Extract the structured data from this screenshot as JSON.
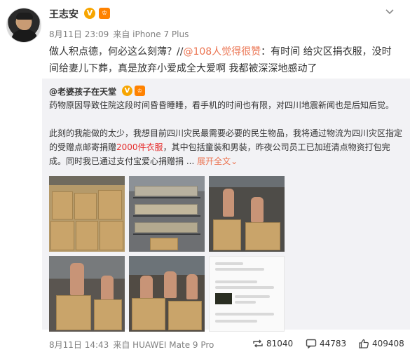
{
  "post": {
    "author": "王志安",
    "verified_badge": "V",
    "level_badge": "♔",
    "time": "8月11日 23:09",
    "source": "来自 iPhone 7 Plus",
    "text_before_mention": "做人积点德，何必这么刻薄？//",
    "mention": "@108人觉得很赞",
    "text_after_mention": "：有时间 给灾区捐衣服，没时间给妻儿下葬，真是放弃小爱成全大爱啊 我都被深深地感动了"
  },
  "repost": {
    "author": "@老婆孩子在天堂",
    "verified_badge": "V",
    "level_badge": "♔",
    "paragraph1": "药物原因导致住院这段时间昏昏睡睡，看手机的时间也有限，对四川地震新闻也是后知后觉。",
    "paragraph2_a": "此刻的我能做的太少，我想目前四川灾民最需要必要的民生物品，我将通过物流为四川灾区指定的受赠点邮寄捐赠",
    "paragraph2_highlight": "2000件衣服",
    "paragraph2_b": "，其中包括童装和男装，昨夜公司员工已加班清点物资打包完成。同时我已通过支付宝爱心捐赠捐 ...",
    "expand_label": "展开全文",
    "expand_arrow": "⌄",
    "time": "8月11日 14:43",
    "source": "来自 HUAWEI Mate 9 Pro",
    "repost_count": "81040",
    "comment_count": "44783",
    "like_count": "409408"
  },
  "icons": {
    "menu": "chevron-down-icon",
    "repost": "repost-icon",
    "comment": "comment-icon",
    "like": "thumb-up-icon"
  },
  "colors": {
    "link": "#eb7350",
    "highlight": "#e62e2e",
    "repost_bg": "#f2f2f5",
    "badge_gold": "#f7a500"
  }
}
